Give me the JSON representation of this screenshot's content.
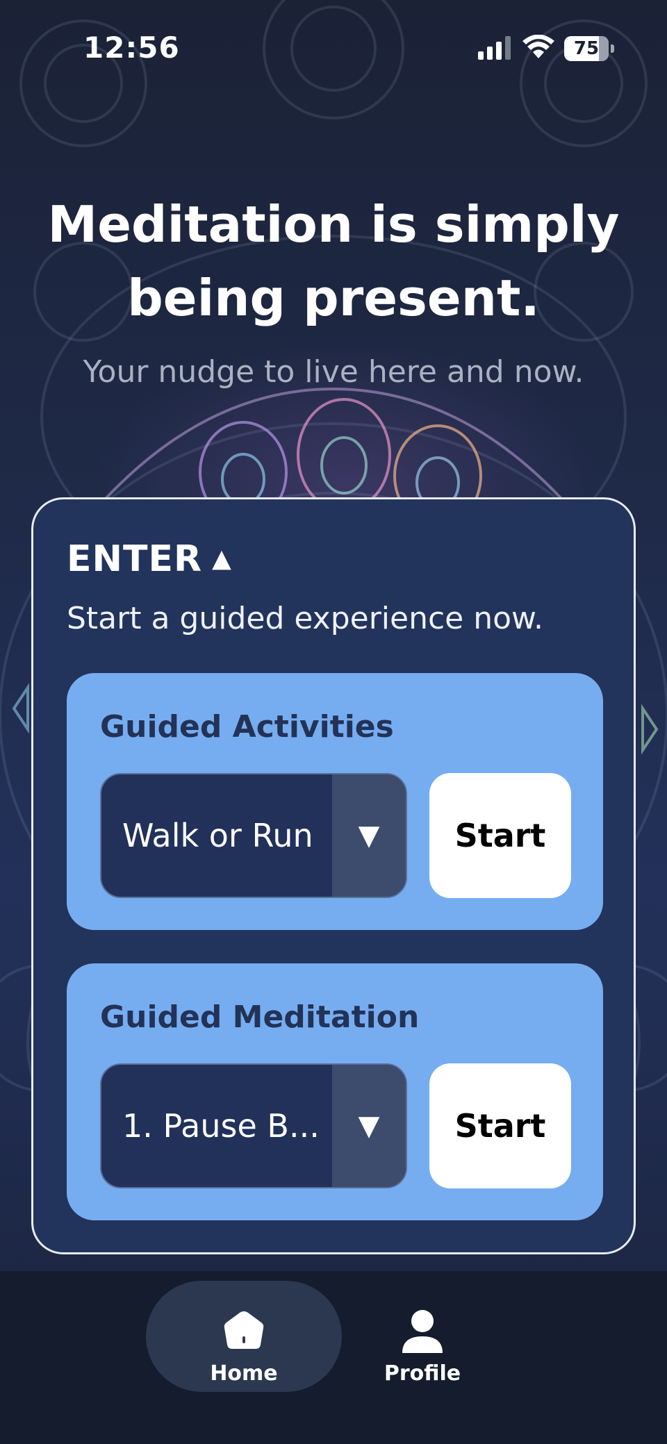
{
  "status_bar": {
    "time": "12:56",
    "battery": "75",
    "icons": [
      "signal-icon",
      "wifi-icon",
      "battery-icon"
    ]
  },
  "hero": {
    "headline_line1": "Meditation is simply",
    "headline_line2": "being present.",
    "subtitle": "Your nudge to live here and now."
  },
  "card": {
    "title": "ENTER",
    "title_icon": "triangle-up-icon",
    "description": "Start a guided experience now.",
    "panels": [
      {
        "title": "Guided Activities",
        "selected": "Walk or Run",
        "dropdown_icon": "triangle-down-icon",
        "button": "Start"
      },
      {
        "title": "Guided Meditation",
        "selected": "1. Pause B...",
        "dropdown_icon": "triangle-down-icon",
        "button": "Start"
      }
    ]
  },
  "tabbar": {
    "tabs": [
      {
        "label": "Home",
        "icon": "home-icon",
        "active": true
      },
      {
        "label": "Profile",
        "icon": "person-icon",
        "active": false
      }
    ]
  },
  "colors": {
    "card_bg": "#22335c",
    "panel_bg": "#76adf0",
    "select_bg": "#22315a",
    "tabbar_bg": "#141c2e",
    "active_tab_bg": "#2c3850"
  }
}
